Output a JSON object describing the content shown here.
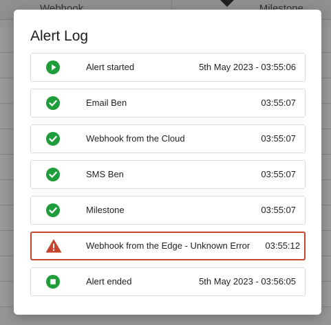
{
  "background": {
    "tabs": [
      {
        "label": "Webhook"
      },
      {
        "label": "Milestone"
      }
    ]
  },
  "modal": {
    "title": "Alert Log",
    "entries": [
      {
        "status": "started",
        "icon": "play-circle-icon",
        "color": "#1f9d3a",
        "label": "Alert started",
        "time": "5th May 2023 - 03:55:06"
      },
      {
        "status": "success",
        "icon": "check-circle-icon",
        "color": "#1f9d3a",
        "label": "Email Ben",
        "time": "03:55:07"
      },
      {
        "status": "success",
        "icon": "check-circle-icon",
        "color": "#1f9d3a",
        "label": "Webhook from the Cloud",
        "time": "03:55:07"
      },
      {
        "status": "success",
        "icon": "check-circle-icon",
        "color": "#1f9d3a",
        "label": "SMS Ben",
        "time": "03:55:07"
      },
      {
        "status": "success",
        "icon": "check-circle-icon",
        "color": "#1f9d3a",
        "label": "Milestone",
        "time": "03:55:07"
      },
      {
        "status": "error",
        "icon": "warning-triangle-icon",
        "color": "#c5452f",
        "label": "Webhook from the Edge - Unknown Error",
        "time": "03:55:12"
      },
      {
        "status": "ended",
        "icon": "stop-circle-icon",
        "color": "#1f9d3a",
        "label": "Alert ended",
        "time": "5th May 2023 - 03:56:05"
      }
    ]
  }
}
